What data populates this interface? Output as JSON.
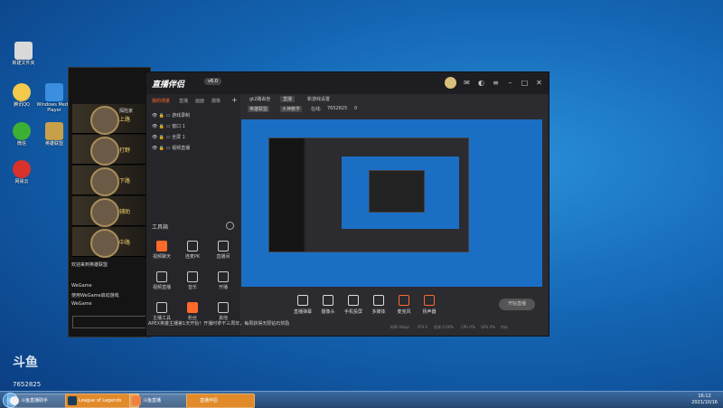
{
  "desktop": {
    "icons": [
      {
        "label": "新建文件夹",
        "icon": "folder-icon",
        "color": "#d9d9d9"
      },
      {
        "label": "腾讯QQ",
        "icon": "qq-icon",
        "color": "#f2c94c"
      },
      {
        "label": "微信",
        "icon": "wechat-icon",
        "color": "#3cb034"
      },
      {
        "label": "网易云",
        "icon": "netease-icon",
        "color": "#d9312b"
      },
      {
        "label": "Windows Media Player",
        "icon": "wmp-icon",
        "color": "#3a8fe0"
      },
      {
        "label": "英雄联盟",
        "icon": "lol-icon",
        "color": "#c8a04a"
      }
    ]
  },
  "game": {
    "champions": [
      {
        "name": "探险家",
        "role": "上路",
        "sub": "",
        "accent": "#c8a04a"
      },
      {
        "name": "",
        "role": "打野",
        "sub": "",
        "accent": "#a0a0a0"
      },
      {
        "name": "",
        "role": "下路",
        "sub": "",
        "accent": "#c8a04a"
      },
      {
        "name": "",
        "role": "辅助",
        "sub": "",
        "accent": "#c8a04a"
      },
      {
        "name": "",
        "role": "中路",
        "sub": "",
        "accent": "#c8a04a"
      }
    ],
    "chat": [
      "欢迎来到英雄联盟",
      "WeGame",
      "使用WeGame启动游戏",
      "WeGame"
    ]
  },
  "stream": {
    "title": "直播伴侣",
    "version": "v6.0",
    "tabs": [
      "我的场景",
      "直播",
      "画面",
      "摄像"
    ],
    "scenes": [
      "游戏录制",
      "窗口 1",
      "全屏 1",
      "视频直播"
    ],
    "info": {
      "a": "gt2路由坐",
      "b": "直播",
      "c": "新游戏设置"
    },
    "status_row": {
      "label1": "英雄联盟",
      "label2": "大神教学",
      "viewers_label": "在线:",
      "viewers": "7652825",
      "likes": "0"
    },
    "tool_header": "工具箱",
    "tools": [
      {
        "label": "视频聊天",
        "icon": "video-chat-icon",
        "hot": true
      },
      {
        "label": "连麦PK",
        "icon": "mic-pk-icon",
        "hot": false
      },
      {
        "label": "直播间",
        "icon": "room-icon",
        "hot": false
      },
      {
        "label": "视频直播",
        "icon": "video-icon",
        "hot": false
      },
      {
        "label": "音乐",
        "icon": "music-icon",
        "hot": false
      },
      {
        "label": "开播",
        "icon": "live-icon",
        "hot": false
      },
      {
        "label": "主播工具",
        "icon": "anchor-icon",
        "hot": false
      },
      {
        "label": "粉丝",
        "icon": "fans-icon",
        "hot": true
      },
      {
        "label": "其他",
        "icon": "more-icon",
        "hot": false
      }
    ],
    "notice": "APEX英雄主播第1天开始！开播时拿不三周年，每周获得无限钻石奖励",
    "bottom": [
      {
        "label": "直播弹幕",
        "icon": "danmaku-icon"
      },
      {
        "label": "摄像头",
        "icon": "camera-icon"
      },
      {
        "label": "手机投屏",
        "icon": "phone-icon"
      },
      {
        "label": "多媒体",
        "icon": "media-icon"
      },
      {
        "label": "麦克风",
        "icon": "mic-icon"
      },
      {
        "label": "扬声器",
        "icon": "speaker-icon"
      }
    ],
    "go_live": "开始直播",
    "stats": [
      "码率 0kbps",
      "FPS 0",
      "丢帧 0.00%",
      "CPU 0%",
      "GPU 0%",
      "内存"
    ]
  },
  "watermark": {
    "logo": "斗鱼",
    "room": "7652825"
  },
  "taskbar": {
    "buttons": [
      {
        "label": "斗鱼直播助手",
        "icon": "chrome-icon",
        "color": "#f2f2f2",
        "active": false
      },
      {
        "label": "League of Legends",
        "icon": "lol-icon",
        "color": "#1a3d5c",
        "active": true
      },
      {
        "label": "斗鱼直播",
        "icon": "douyu-icon",
        "color": "#f08040",
        "active": false
      },
      {
        "label": "直播伴侣",
        "icon": "obs-icon",
        "color": "#e08a2a",
        "active": true
      }
    ],
    "clock": {
      "time": "16:12",
      "date": "2021/10/16"
    }
  }
}
